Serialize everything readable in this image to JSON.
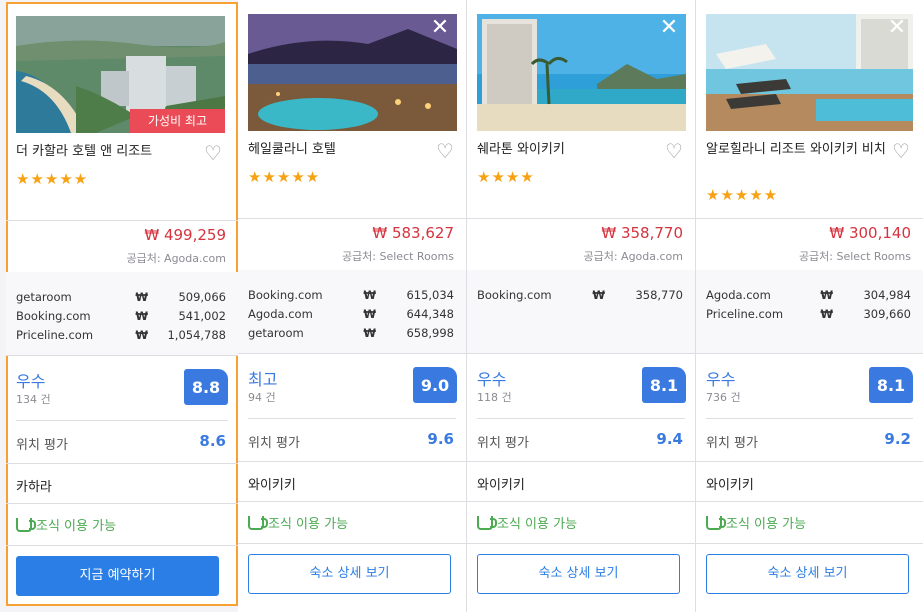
{
  "colors": {
    "accent": "#3a7ae0",
    "price_red": "#d5333e",
    "highlight_border": "#f7a033",
    "badge": "#ea4b56",
    "breakfast_green": "#4caa52",
    "star": "#f7a214"
  },
  "cards": [
    {
      "name": "더 카할라 호텔 앤 리조트",
      "badge": "가성비 최고",
      "stars": "★★★★★",
      "price": "₩ 499,259",
      "provider": "공급처: Agoda.com",
      "alternatives": [
        {
          "site": "getaroom",
          "currency": "₩",
          "price": "509,066"
        },
        {
          "site": "Booking.com",
          "currency": "₩",
          "price": "541,002"
        },
        {
          "site": "Priceline.com",
          "currency": "₩",
          "price": "1,054,788"
        }
      ],
      "rating_word": "우수",
      "reviews": "134 건",
      "score": "8.8",
      "location_label": "위치 평가",
      "location_score": "8.6",
      "area": "카하라",
      "breakfast": "조식 이용 가능",
      "button": "지금 예약하기"
    },
    {
      "name": "헤일쿨라니 호텔",
      "stars": "★★★★★",
      "price": "₩ 583,627",
      "provider": "공급처: Select Rooms",
      "alternatives": [
        {
          "site": "Booking.com",
          "currency": "₩",
          "price": "615,034"
        },
        {
          "site": "Agoda.com",
          "currency": "₩",
          "price": "644,348"
        },
        {
          "site": "getaroom",
          "currency": "₩",
          "price": "658,998"
        }
      ],
      "rating_word": "최고",
      "reviews": "94 건",
      "score": "9.0",
      "location_label": "위치 평가",
      "location_score": "9.6",
      "area": "와이키키",
      "breakfast": "조식 이용 가능",
      "button": "숙소 상세 보기",
      "close": "✕"
    },
    {
      "name": "쉐라톤 와이키키",
      "stars": "★★★★",
      "price": "₩ 358,770",
      "provider": "공급처: Agoda.com",
      "alternatives": [
        {
          "site": "Booking.com",
          "currency": "₩",
          "price": "358,770"
        }
      ],
      "rating_word": "우수",
      "reviews": "118 건",
      "score": "8.1",
      "location_label": "위치 평가",
      "location_score": "9.4",
      "area": "와이키키",
      "breakfast": "조식 이용 가능",
      "button": "숙소 상세 보기",
      "close": "✕"
    },
    {
      "name": "알로힐라니 리조트 와이키키 비치",
      "stars": "★★★★★",
      "price": "₩ 300,140",
      "provider": "공급처: Select Rooms",
      "alternatives": [
        {
          "site": "Agoda.com",
          "currency": "₩",
          "price": "304,984"
        },
        {
          "site": "Priceline.com",
          "currency": "₩",
          "price": "309,660"
        }
      ],
      "rating_word": "우수",
      "reviews": "736 건",
      "score": "8.1",
      "location_label": "위치 평가",
      "location_score": "9.2",
      "area": "와이키키",
      "breakfast": "조식 이용 가능",
      "button": "숙소 상세 보기",
      "close": "✕"
    }
  ]
}
